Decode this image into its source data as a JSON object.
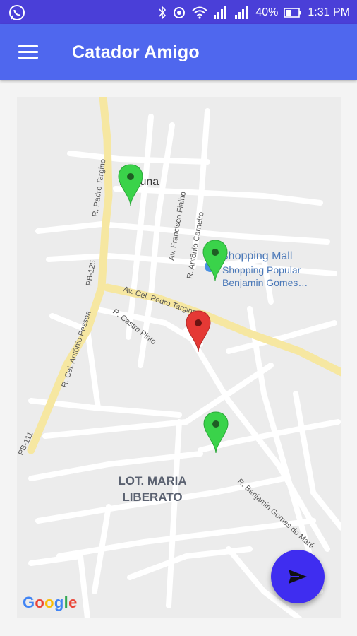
{
  "status_bar": {
    "battery": "40%",
    "time": "1:31 PM",
    "icons": [
      "whatsapp-icon",
      "bluetooth-icon",
      "sync-icon",
      "wifi-icon",
      "signal-icon",
      "signal-icon",
      "battery-icon"
    ]
  },
  "toolbar": {
    "title": "Catador Amigo",
    "menu_icon": "hamburger-menu-icon"
  },
  "map": {
    "street_labels": {
      "padre_targino": "R. Padre Targino",
      "pb125": "PB-125",
      "cel_antonio_pessoa": "R. Cel. Antônio Pessoa",
      "pb111": "PB-111",
      "francisco_fialho": "Av. Francisco Fialho",
      "antonio_carneiro": "R. Antônio Carneiro",
      "cel_pedro_targino": "Av. Cel. Pedro Targino",
      "castro_pinto": "R. Castro Pinto",
      "benjamin_gomes": "R. Benjamin Gomes do Maré"
    },
    "place_labels": {
      "place_partial": "Areiuna",
      "shopping_mall": "Shopping Mall",
      "shopping_popular_1": "Shopping Popular",
      "shopping_popular_2": "Benjamin Gomes…",
      "district_1": "LOT. MARIA",
      "district_2": "LIBERATO"
    },
    "markers": [
      {
        "type": "collection-point",
        "color": "#3ad34a"
      },
      {
        "type": "collection-point",
        "color": "#3ad34a"
      },
      {
        "type": "current-location",
        "color": "#e53935"
      },
      {
        "type": "collection-point",
        "color": "#3ad34a"
      }
    ],
    "attribution": "Google"
  },
  "fab": {
    "icon": "send-icon",
    "color": "#3f2df0"
  },
  "colors": {
    "status_bar": "#4a3fd8",
    "toolbar": "#4f67ee",
    "marker_green": "#3ad34a",
    "marker_red": "#e53935",
    "main_road": "#f6e7a1"
  }
}
